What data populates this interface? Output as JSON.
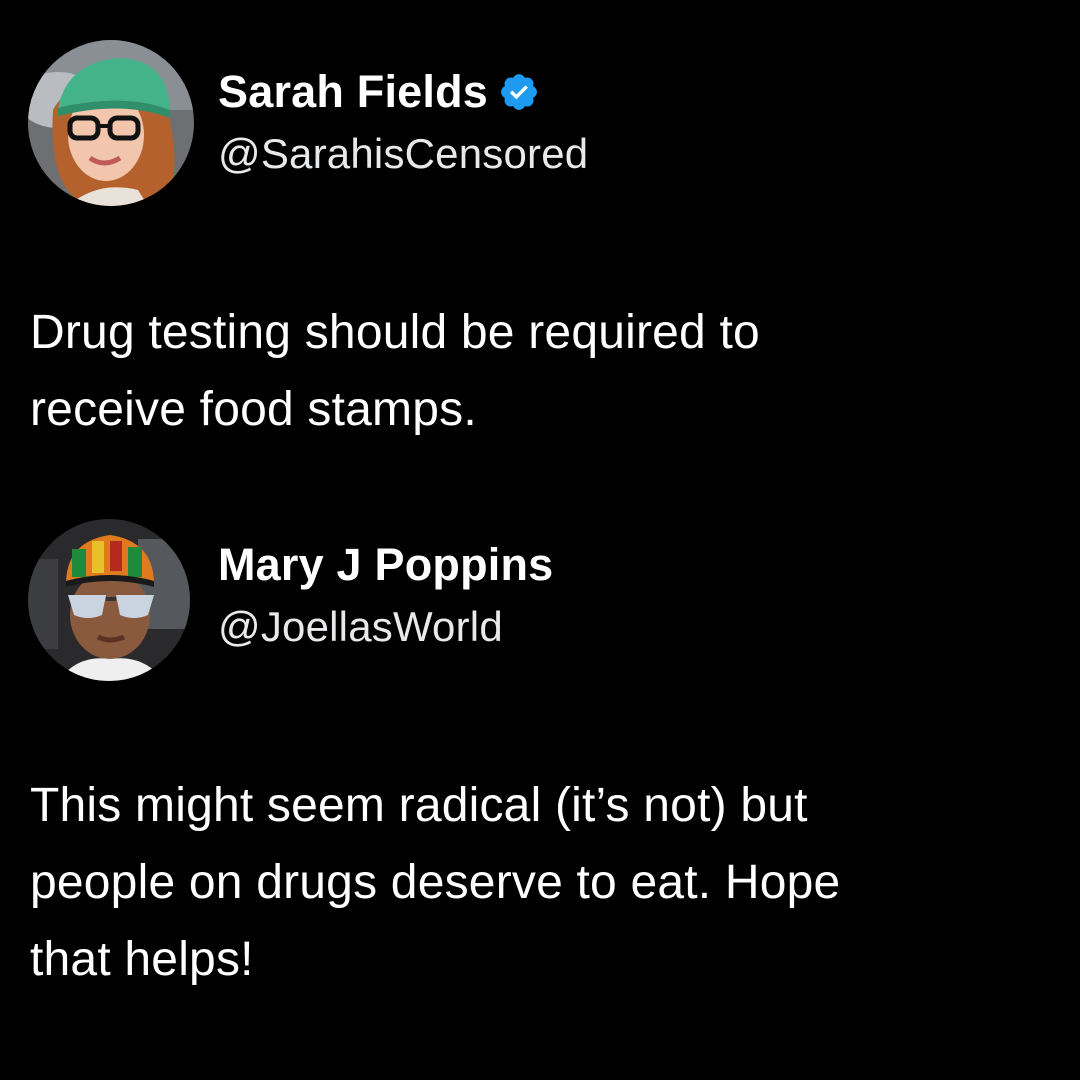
{
  "tweet": {
    "author_name": "Sarah Fields",
    "author_handle": "@SarahisCensored",
    "verified": true,
    "avatar_icon": "profile-photo-woman-green-beanie",
    "text_lines": [
      "Drug testing should be required to",
      "receive food stamps."
    ]
  },
  "reply": {
    "author_name": "Mary J Poppins",
    "author_handle": "@JoellasWorld",
    "verified": false,
    "avatar_icon": "profile-photo-person-kente-hat",
    "text_lines": [
      "This might seem radical (it’s not) but",
      "people on drugs deserve to eat. Hope",
      "that helps!"
    ]
  },
  "colors": {
    "background": "#000000",
    "text": "#ffffff",
    "verified_badge": "#1d9bf0"
  }
}
